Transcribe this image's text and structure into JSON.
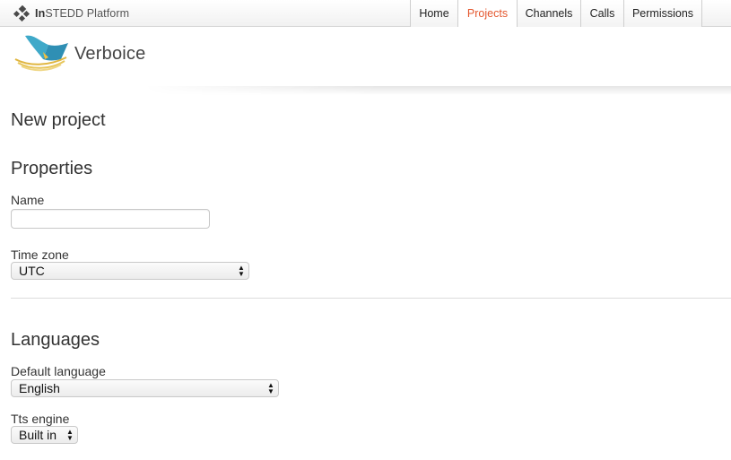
{
  "platform": {
    "brand_bold": "In",
    "brand_rest": "STEDD Platform",
    "icon": "instedd-logo-icon"
  },
  "nav": {
    "tabs": [
      {
        "label": "Home",
        "active": false
      },
      {
        "label": "Projects",
        "active": true
      },
      {
        "label": "Channels",
        "active": false
      },
      {
        "label": "Calls",
        "active": false
      },
      {
        "label": "Permissions",
        "active": false
      }
    ],
    "active_color": "#e4572e"
  },
  "brand": {
    "name": "Verboice",
    "logo": "verboice-logo-icon"
  },
  "page": {
    "title": "New project"
  },
  "properties": {
    "heading": "Properties",
    "name_label": "Name",
    "name_value": "",
    "timezone_label": "Time zone",
    "timezone_value": "UTC"
  },
  "languages": {
    "heading": "Languages",
    "default_label": "Default language",
    "default_value": "English",
    "tts_label": "Tts engine",
    "tts_value": "Built in"
  }
}
